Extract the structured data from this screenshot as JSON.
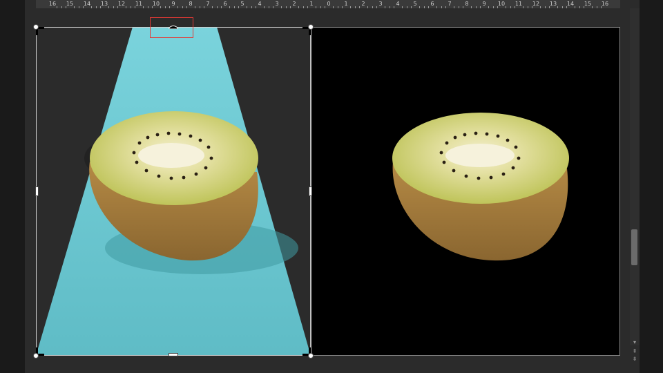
{
  "ruler": {
    "labels": [
      "16",
      "15",
      "14",
      "13",
      "12",
      "11",
      "10",
      "9",
      "8",
      "7",
      "6",
      "5",
      "4",
      "3",
      "2",
      "1",
      "0",
      "1",
      "2",
      "3",
      "4",
      "5",
      "6",
      "7",
      "8",
      "9",
      "10",
      "11",
      "12",
      "13",
      "14",
      "15",
      "16"
    ]
  },
  "icons": {
    "scroll_down": "▾",
    "page_up": "⇞",
    "page_down": "⇟"
  },
  "colors": {
    "background_blue": "#6cc6cf",
    "selection_highlight": "#e53935",
    "kiwi_flesh": "#c7cc62",
    "kiwi_skin": "#a77a3c"
  }
}
